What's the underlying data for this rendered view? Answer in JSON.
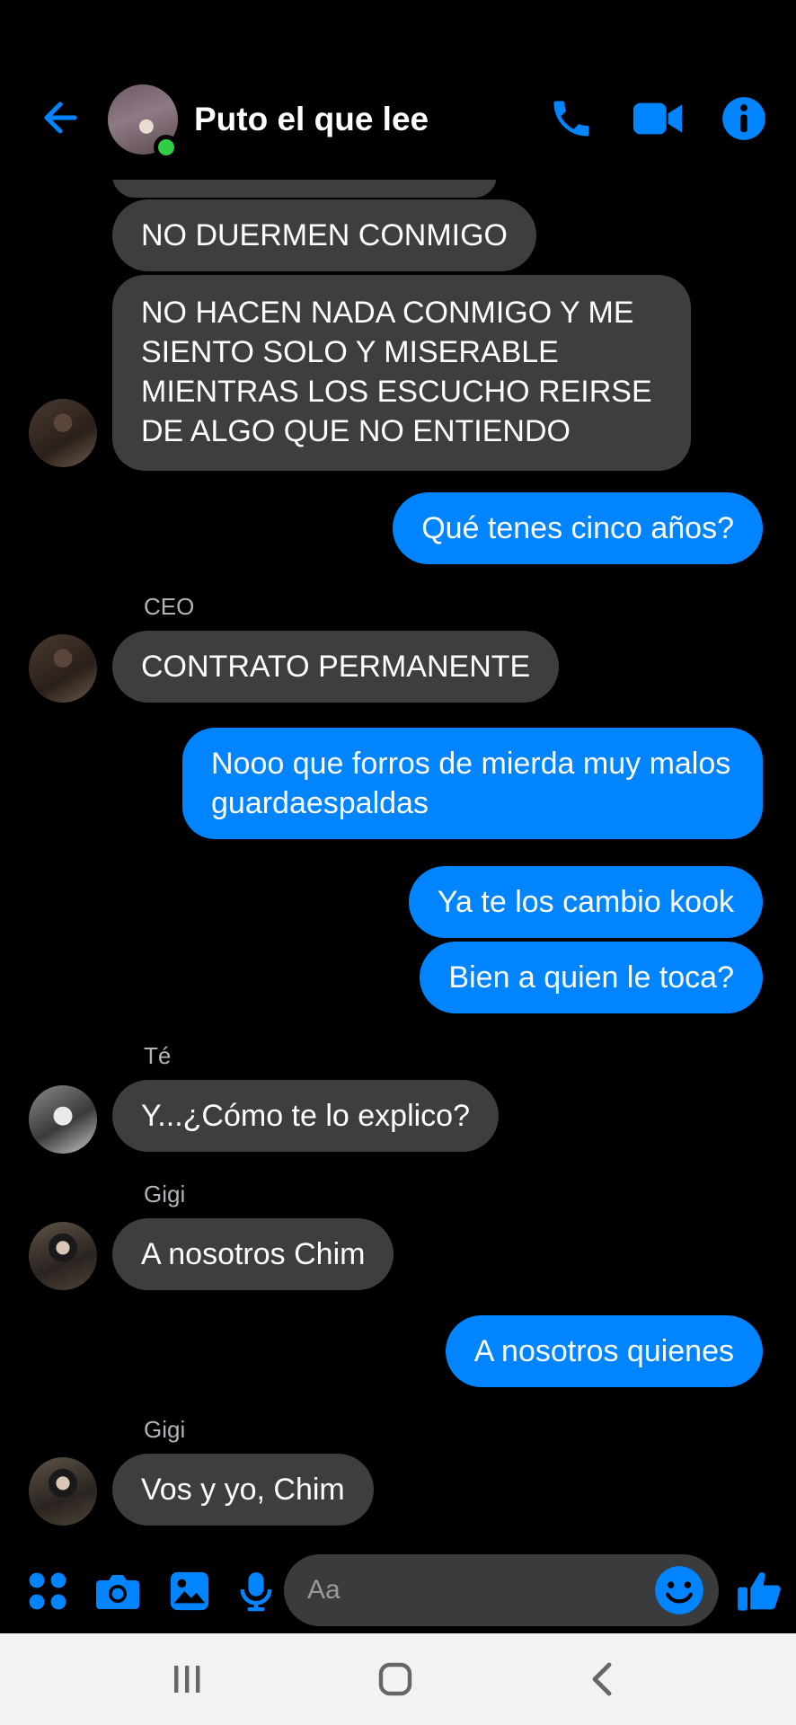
{
  "header": {
    "title": "Puto el que lee",
    "icons": [
      "back-arrow-icon",
      "phone-icon",
      "video-camera-icon",
      "info-icon"
    ],
    "accent_color": "#0084ff",
    "online_color": "#31cc46"
  },
  "messages": {
    "m1": "NO DUERMEN CONMIGO",
    "m2": "NO HACEN NADA CONMIGO Y ME SIENTO SOLO Y MISERABLE MIENTRAS LOS ESCUCHO REIRSE DE ALGO QUE NO ENTIENDO",
    "m3": "Qué tenes cinco años?",
    "sender_ceo": "CEO",
    "m4": "CONTRATO PERMANENTE",
    "m5": "Nooo que forros de mierda muy malos guardaespaldas",
    "m6": "Ya te los cambio kook",
    "m7": "Bien a quien le toca?",
    "sender_te": "Té",
    "m8": "Y...¿Cómo te lo explico?",
    "sender_gigi_1": "Gigi",
    "m9": "A nosotros Chim",
    "m10": "A nosotros quienes",
    "sender_gigi_2": "Gigi",
    "m11": "Vos y yo, Chim",
    "incoming_color": "#3e3e3e",
    "outgoing_color": "#0084ff"
  },
  "composer": {
    "placeholder": "Aa",
    "icons": [
      "apps-icon",
      "camera-icon",
      "gallery-icon",
      "microphone-icon",
      "emoji-icon",
      "thumbs-up-icon"
    ]
  },
  "navbar": {
    "icons": [
      "recent-apps-icon",
      "home-icon",
      "back-icon"
    ]
  }
}
